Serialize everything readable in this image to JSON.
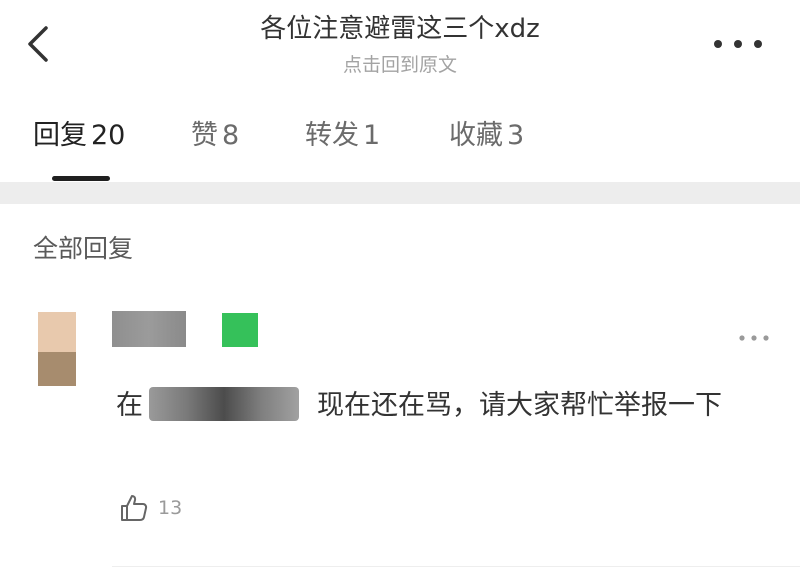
{
  "header": {
    "title": "各位注意避雷这三个xdz",
    "subtitle": "点击回到原文"
  },
  "tabs": [
    {
      "label": "回复",
      "count": "20",
      "active": true
    },
    {
      "label": "赞",
      "count": "8",
      "active": false
    },
    {
      "label": "转发",
      "count": "1",
      "active": false
    },
    {
      "label": "收藏",
      "count": "3",
      "active": false
    }
  ],
  "section": {
    "title": "全部回复"
  },
  "comment": {
    "text_before": "在",
    "text_after": "现在还在骂，请大家帮忙举报一下",
    "like_count": "13"
  },
  "colors": {
    "level_badge": "#35c15a",
    "tab_indicator": "#1f1f1f",
    "band": "#ededed",
    "subtitle": "#a3a3a3"
  },
  "icons": {
    "back": "back-arrow-icon",
    "more": "more-dots-icon",
    "like": "thumbs-up-icon"
  }
}
